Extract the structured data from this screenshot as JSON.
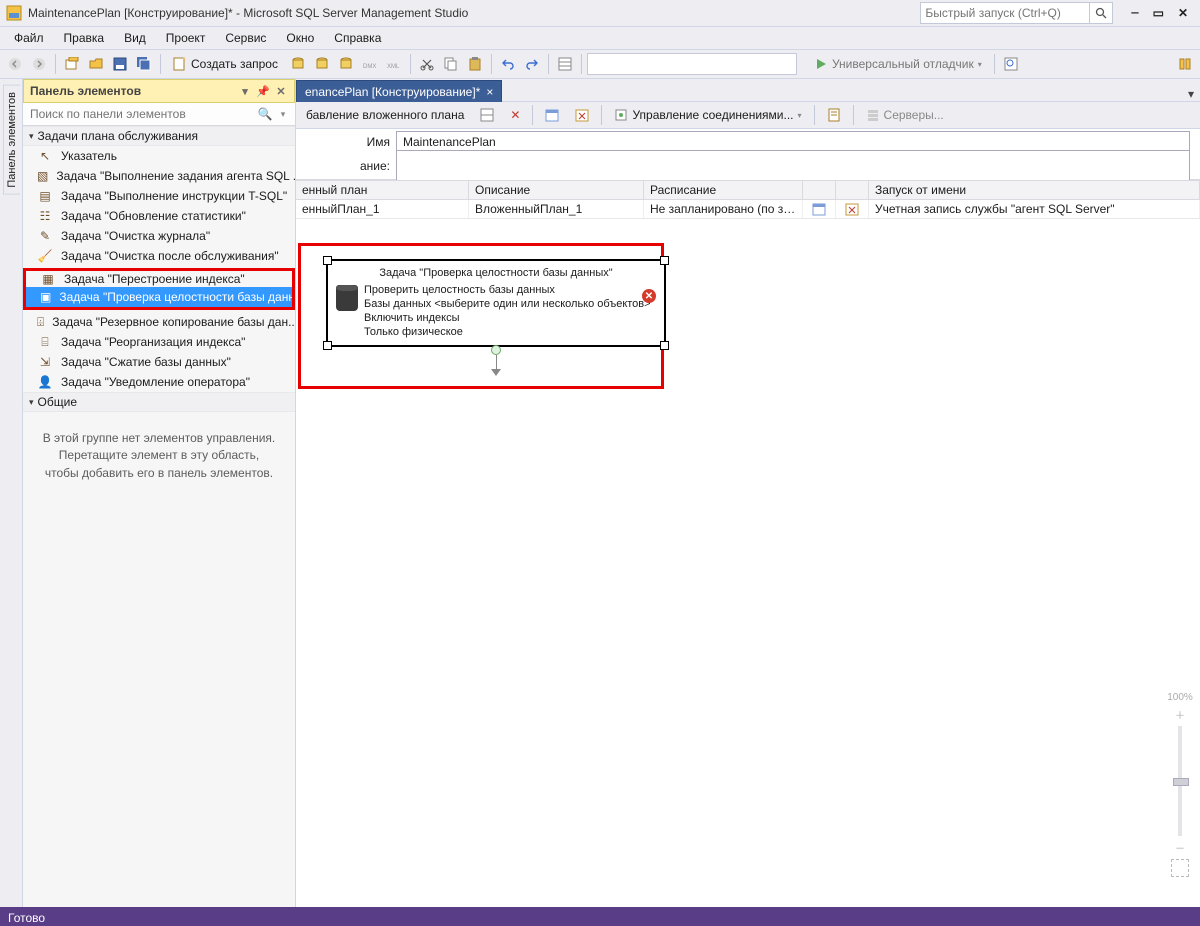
{
  "titlebar": {
    "title": "MaintenancePlan [Конструирование]* - Microsoft SQL Server Management Studio",
    "quick_launch_placeholder": "Быстрый запуск (Ctrl+Q)"
  },
  "menubar": {
    "items": [
      "Файл",
      "Правка",
      "Вид",
      "Проект",
      "Сервис",
      "Окно",
      "Справка"
    ]
  },
  "toolbar": {
    "new_query_label": "Создать запрос",
    "debugger_label": "Универсальный отладчик"
  },
  "left_rail": {
    "tab_label": "Панель элементов"
  },
  "toolbox": {
    "header": "Панель элементов",
    "search_placeholder": "Поиск по панели элементов",
    "groups": {
      "maint": {
        "title": "Задачи плана обслуживания",
        "items": [
          "Указатель",
          "Задача \"Выполнение задания агента SQL ...",
          "Задача \"Выполнение инструкции T-SQL\"",
          "Задача \"Обновление статистики\"",
          "Задача \"Очистка журнала\"",
          "Задача \"Очистка после обслуживания\"",
          "Задача \"Перестроение индекса\"",
          "Задача \"Проверка целостности базы данн...",
          "Задача \"Резервное копирование базы дан...",
          "Задача \"Реорганизация индекса\"",
          "Задача \"Сжатие базы данных\"",
          "Задача \"Уведомление оператора\""
        ]
      },
      "common": {
        "title": "Общие"
      }
    },
    "help_line1": "В этой группе нет элементов управления.",
    "help_line2": "Перетащите элемент в эту область, чтобы добавить его в панель элементов."
  },
  "doc_tab": {
    "label": "enancePlan [Конструирование]*"
  },
  "doc_toolbar": {
    "add_subplan_label": "бавление вложенного плана",
    "manage_conn_label": "Управление соединениями...",
    "servers_label": "Серверы..."
  },
  "form": {
    "name_label": "Имя",
    "name_value": "MaintenancePlan",
    "desc_label": "ание:"
  },
  "grid": {
    "headers": {
      "subplan": "енный план",
      "description": "Описание",
      "schedule": "Расписание",
      "runas": "Запуск от имени"
    },
    "row": {
      "subplan": "енныйПлан_1",
      "description": "ВложенныйПлан_1",
      "schedule": "Не запланировано (по з…",
      "runas": "Учетная запись службы \"агент SQL Server\""
    }
  },
  "task_node": {
    "title": "Задача \"Проверка целостности базы данных\"",
    "line1": "Проверить целостность базы данных",
    "line2": "Базы данных <выберите один или несколько объектов>",
    "line3": "Включить индексы",
    "line4": "Только физическое"
  },
  "zoom": {
    "percent_label": "100%"
  },
  "statusbar": {
    "text": "Готово"
  }
}
